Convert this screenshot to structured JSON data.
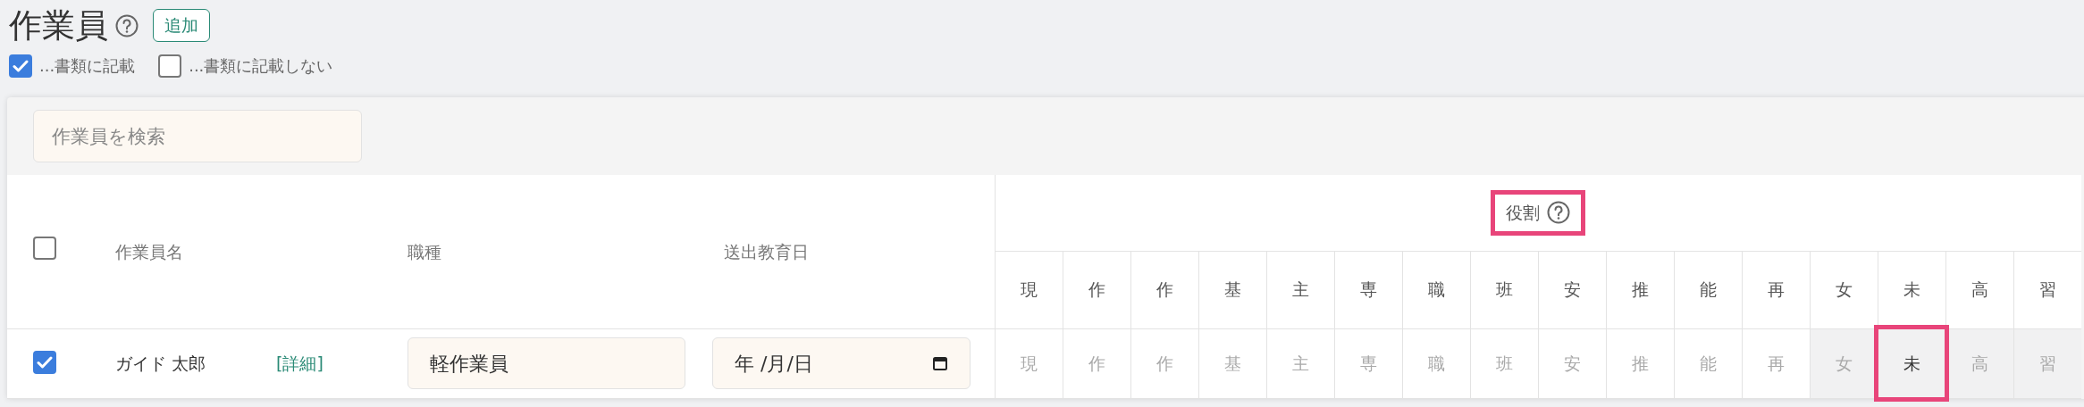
{
  "title": "作業員",
  "add_button": "追加",
  "filters": [
    {
      "label": "...書類に記載",
      "checked": true
    },
    {
      "label": "...書類に記載しない",
      "checked": false
    }
  ],
  "search": {
    "placeholder": "作業員を検索"
  },
  "table": {
    "select_all": {
      "checked": false
    },
    "columns": [
      "作業員名",
      "職種",
      "送出教育日"
    ],
    "roles_header": {
      "label": "役割",
      "highlighted": true
    },
    "role_columns": [
      "現",
      "作",
      "作",
      "基",
      "主",
      "専",
      "職",
      "班",
      "安",
      "推",
      "能",
      "再",
      "女",
      "未",
      "高",
      "習"
    ],
    "rows": [
      {
        "checked": true,
        "name": "ガイド 太郎",
        "detail_link": "[詳細]",
        "job_type": "軽作業員",
        "dispatch_date": "年 /月/日",
        "roles": [
          {
            "label": "現",
            "disabled": false,
            "selected": false,
            "highlighted": false
          },
          {
            "label": "作",
            "disabled": false,
            "selected": false,
            "highlighted": false
          },
          {
            "label": "作",
            "disabled": false,
            "selected": false,
            "highlighted": false
          },
          {
            "label": "基",
            "disabled": false,
            "selected": false,
            "highlighted": false
          },
          {
            "label": "主",
            "disabled": false,
            "selected": false,
            "highlighted": false
          },
          {
            "label": "専",
            "disabled": false,
            "selected": false,
            "highlighted": false
          },
          {
            "label": "職",
            "disabled": false,
            "selected": false,
            "highlighted": false
          },
          {
            "label": "班",
            "disabled": false,
            "selected": false,
            "highlighted": false
          },
          {
            "label": "安",
            "disabled": false,
            "selected": false,
            "highlighted": false
          },
          {
            "label": "推",
            "disabled": false,
            "selected": false,
            "highlighted": false
          },
          {
            "label": "能",
            "disabled": false,
            "selected": false,
            "highlighted": false
          },
          {
            "label": "再",
            "disabled": false,
            "selected": false,
            "highlighted": false
          },
          {
            "label": "女",
            "disabled": true,
            "selected": false,
            "highlighted": false
          },
          {
            "label": "未",
            "disabled": true,
            "selected": true,
            "highlighted": true
          },
          {
            "label": "高",
            "disabled": true,
            "selected": false,
            "highlighted": false
          },
          {
            "label": "習",
            "disabled": true,
            "selected": false,
            "highlighted": false
          }
        ]
      }
    ]
  }
}
